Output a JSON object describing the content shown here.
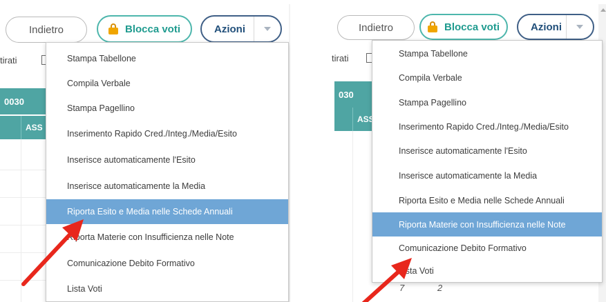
{
  "toolbar": {
    "back_label": "Indietro",
    "lock_label": "Blocca voti",
    "actions_label": "Azioni"
  },
  "background": {
    "filter_label": "tirati",
    "band_code_left": "0030",
    "band_code_right": "030",
    "column_header": "ASS",
    "bottom_values": [
      "7",
      "2"
    ]
  },
  "menu_items": [
    "Stampa Tabellone",
    "Compila Verbale",
    "Stampa Pagellino",
    "Inserimento Rapido Cred./Integ./Media/Esito",
    "Inserisce automaticamente l'Esito",
    "Inserisce automaticamente la Media",
    "Riporta Esito e Media nelle Schede Annuali",
    "Riporta Materie con Insufficienza nelle Note",
    "Comunicazione Debito Formativo",
    "Lista Voti"
  ],
  "left_panel": {
    "highlighted_item": "Riporta Esito e Media nelle Schede Annuali"
  },
  "right_panel": {
    "highlighted_item": "Riporta Materie con Insufficienza nelle Note"
  },
  "colors": {
    "highlight": "#6fa6d6",
    "teal": "#4fa5a3",
    "lock_accent": "#4db6ac",
    "actions_border": "#3f5f86",
    "arrow": "#e8271c"
  },
  "icons": [
    "lock-icon",
    "caret-down-icon",
    "red-arrow-pointer"
  ]
}
